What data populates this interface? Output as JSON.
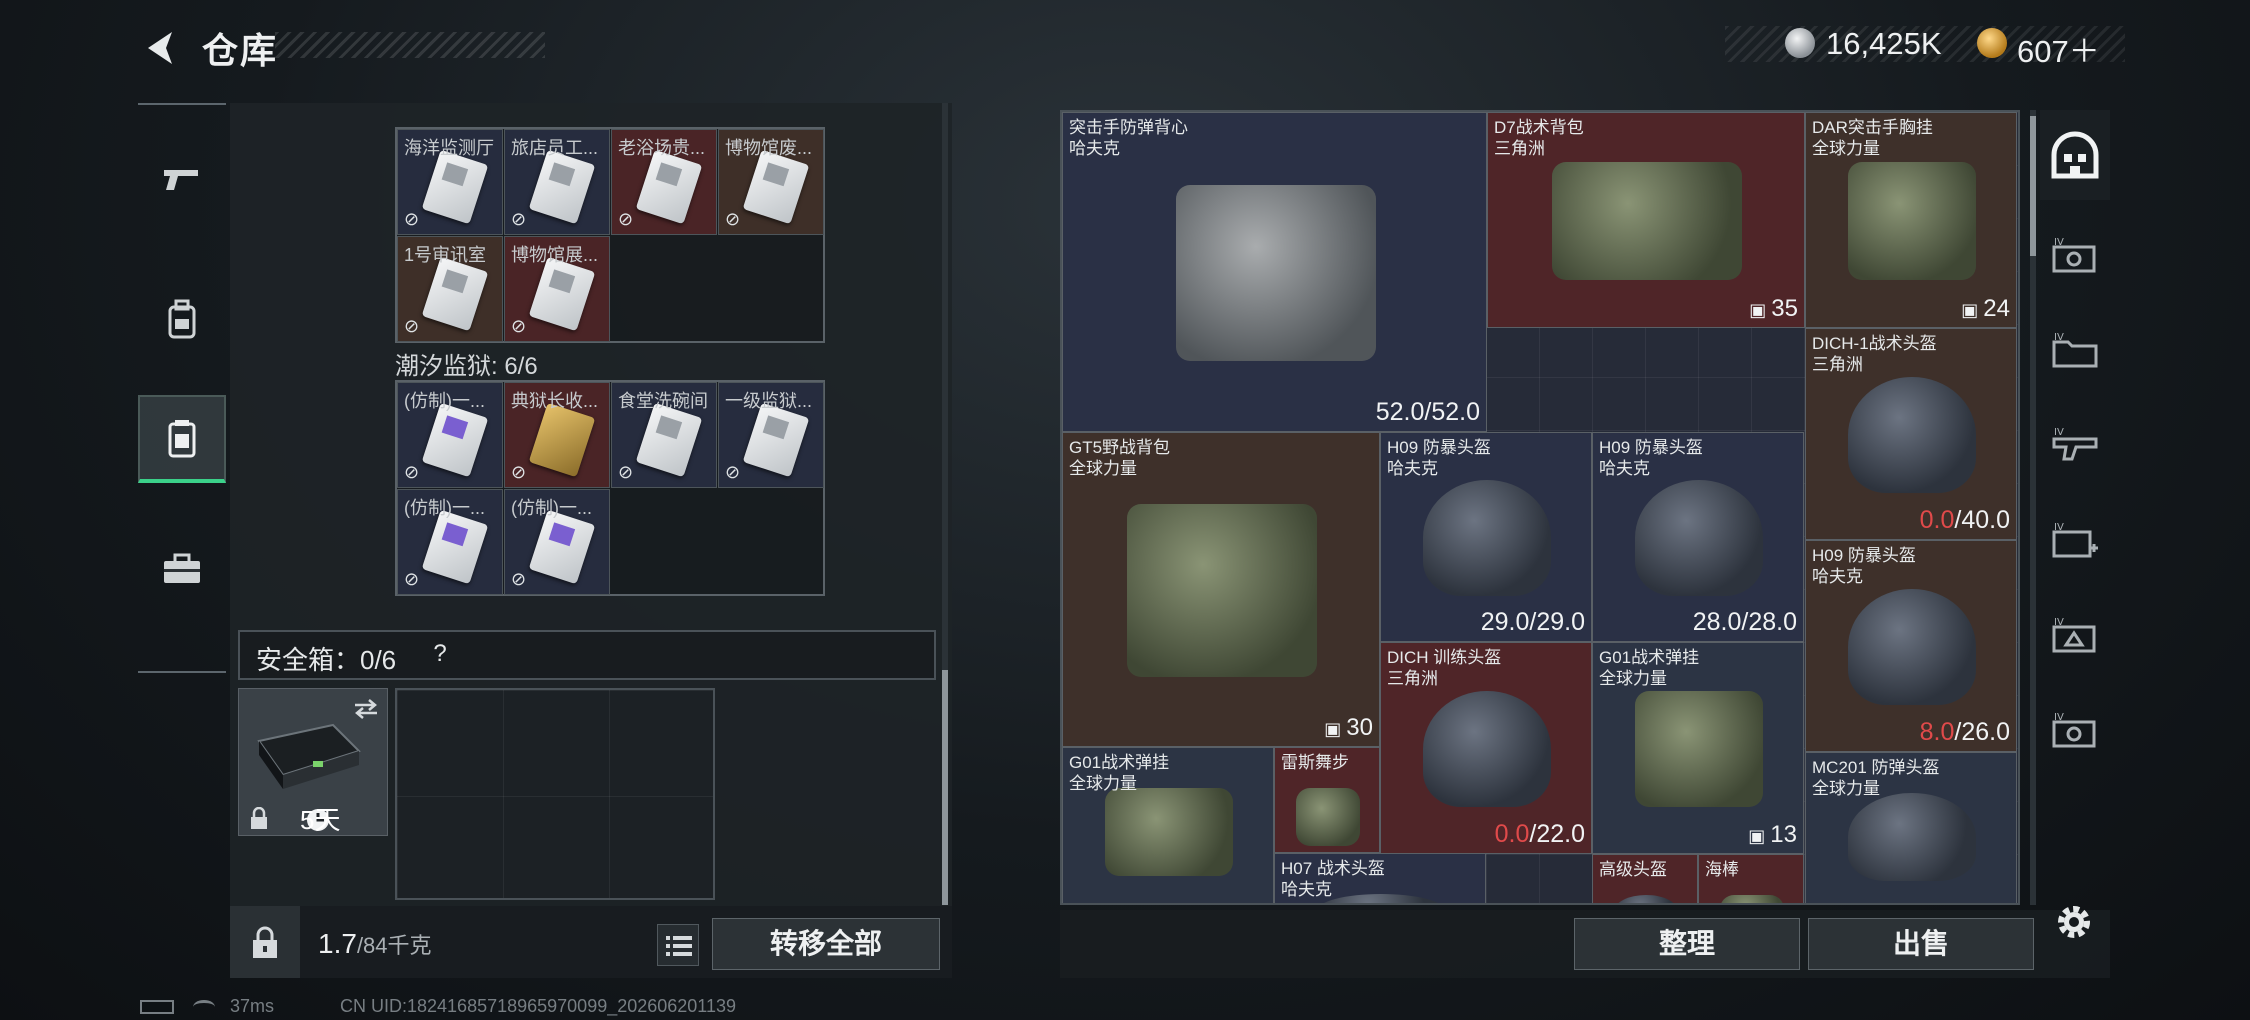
{
  "header": {
    "title": "仓库",
    "money": "16,425K",
    "gold": "607＋"
  },
  "left_nav": [
    "pistol-icon",
    "backpack-icon",
    "storage-icon",
    "briefcase-icon"
  ],
  "collection": {
    "top_cards": [
      {
        "label": "海洋监测厅",
        "color": "navy",
        "card": "gray"
      },
      {
        "label": "旅店员工...",
        "color": "navy",
        "card": "gray"
      },
      {
        "label": "老浴场贵...",
        "color": "red",
        "card": "gray"
      },
      {
        "label": "博物馆废...",
        "color": "brown",
        "card": "gray"
      },
      {
        "label": "1号审讯室",
        "color": "brown",
        "card": "gray"
      },
      {
        "label": "博物馆展...",
        "color": "red",
        "card": "gray"
      }
    ],
    "prison_title": "潮汐监狱: 6/6",
    "prison_cards": [
      {
        "label": "(仿制)一...",
        "color": "navy",
        "card": "purple"
      },
      {
        "label": "典狱长收...",
        "color": "red",
        "card": "gold-knife"
      },
      {
        "label": "食堂洗碗间",
        "color": "navy",
        "card": "gray"
      },
      {
        "label": "一级监狱...",
        "color": "navy",
        "card": "gray"
      },
      {
        "label": "(仿制)一...",
        "color": "navy",
        "card": "purple"
      },
      {
        "label": "(仿制)一...",
        "color": "navy",
        "card": "purple"
      }
    ]
  },
  "safe_box": {
    "label": "安全箱：0/6",
    "help": "?",
    "days": "5天"
  },
  "footer_left": {
    "weight": "1.7",
    "weight_unit": "/84千克",
    "transfer_all": "转移全部"
  },
  "stash_items": [
    {
      "name": "突击手防弹背心",
      "maker": "哈夫克",
      "color": "navy",
      "value": "52.0/52.0",
      "kind": "durability"
    },
    {
      "name": "D7战术背包",
      "maker": "三角洲",
      "color": "red",
      "value": "35",
      "kind": "stack"
    },
    {
      "name": "DAR突击手胸挂",
      "maker": "全球力量",
      "color": "brown",
      "value": "24",
      "kind": "stack"
    },
    {
      "name": "DICH-1战术头盔",
      "maker": "三角洲",
      "color": "brown",
      "zero": "0.0",
      "value": "/40.0",
      "kind": "durability-zero"
    },
    {
      "name": "GT5野战背包",
      "maker": "全球力量",
      "color": "brown",
      "value": "30",
      "kind": "stack"
    },
    {
      "name": "H09 防暴头盔",
      "maker": "哈夫克",
      "color": "navy",
      "value": "29.0/29.0",
      "kind": "durability"
    },
    {
      "name": "H09 防暴头盔",
      "maker": "哈夫克",
      "color": "navy",
      "value": "28.0/28.0",
      "kind": "durability"
    },
    {
      "name": "H09 防暴头盔",
      "maker": "哈夫克",
      "color": "brown",
      "zero": "8.0",
      "value": "/26.0",
      "kind": "durability-zero"
    },
    {
      "name": "DICH 训练头盔",
      "maker": "三角洲",
      "color": "red",
      "zero": "0.0",
      "value": "/22.0",
      "kind": "durability-zero"
    },
    {
      "name": "G01战术弹挂",
      "maker": "全球力量",
      "color": "slate",
      "value": "13",
      "kind": "stack"
    },
    {
      "name": "G01战术弹挂",
      "maker": "全球力量",
      "color": "slate",
      "value": "",
      "kind": "none"
    },
    {
      "name": "雷斯舞步",
      "maker": "",
      "color": "red",
      "value": "",
      "kind": "none"
    },
    {
      "name": "MC201 防弹头盔",
      "maker": "全球力量",
      "color": "slate",
      "value": "",
      "kind": "none"
    },
    {
      "name": "H07 战术头盔",
      "maker": "哈夫克",
      "color": "navy",
      "value": "",
      "kind": "none"
    },
    {
      "name": "高级头盔",
      "maker": "",
      "color": "red",
      "value": "",
      "kind": "none"
    },
    {
      "name": "海棒",
      "maker": "",
      "color": "red",
      "value": "",
      "kind": "none"
    }
  ],
  "footer_right": {
    "sort": "整理",
    "sell": "出售"
  },
  "status": {
    "ping": "37ms",
    "uid": "CN UID:18241685718965970099_202606201139"
  }
}
